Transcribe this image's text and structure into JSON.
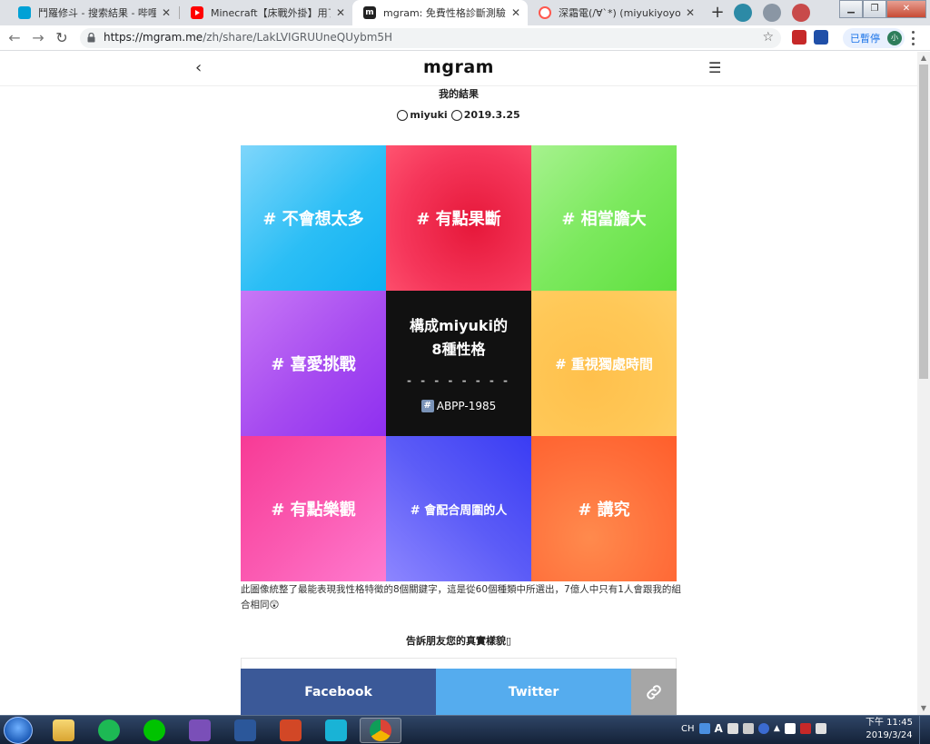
{
  "browser": {
    "tabs": [
      {
        "title": "鬥羅修斗 - 搜索結果 - 哔哩哔哩弹",
        "favicon": "bilibili-icon",
        "color": "#00a1d6"
      },
      {
        "title": "Minecraft【床戰外掛】用了會上",
        "favicon": "youtube-icon",
        "color": "#ff0000"
      },
      {
        "title": "mgram: 免費性格診斷測驗，構成",
        "favicon": "mgram-icon",
        "color": "#111111"
      },
      {
        "title": "深霜電(/∀`*) (miyukiyoyoru) 在",
        "favicon": "plurk-icon",
        "color": "#ff574d"
      }
    ],
    "active_tab": 2,
    "new_tab_label": "+",
    "url_host": "https://mgram.me",
    "url_path": "/zh/share/LakLVIGRUUneQUybm5H",
    "profile_label": "已暫停",
    "profile_initial": "小"
  },
  "site": {
    "logo": "mgram",
    "back_label": "‹",
    "menu_label": "☰",
    "result_title": "我的結果",
    "user": "miyuki",
    "date": "2019.3.25"
  },
  "grid": {
    "cells": [
      "# 不會想太多",
      "# 有點果斷",
      "# 相當膽大",
      "# 喜愛挑戰",
      "",
      "# 重視獨處時間",
      "# 有點樂觀",
      "# 會配合周圍的人",
      "# 講究"
    ],
    "center_line1": "構成miyuki的",
    "center_line2": "8種性格",
    "center_dashes": "- - - - - - - -",
    "center_code": "ABPP-1985"
  },
  "description": "此圖像統整了最能表現我性格特徵的8個關鍵字，這是從60個種類中所選出，7億人中只有1人會跟我的組合相同😲",
  "share": {
    "prompt": "告訴朋友您的真實樣貌▯",
    "facebook": "Facebook",
    "twitter": "Twitter",
    "link_icon": "link-icon"
  },
  "taskbar": {
    "apps": [
      "explorer-icon",
      "spotify-icon",
      "line-icon",
      "visual-studio-icon",
      "word-icon",
      "powerpoint-icon",
      "kk-icon",
      "chrome-icon"
    ],
    "lang": "CH",
    "time": "下午 11:45",
    "date": "2019/3/24"
  },
  "colors": {
    "facebook": "#3b5998",
    "twitter": "#55acee",
    "link": "#a6a6a6"
  }
}
